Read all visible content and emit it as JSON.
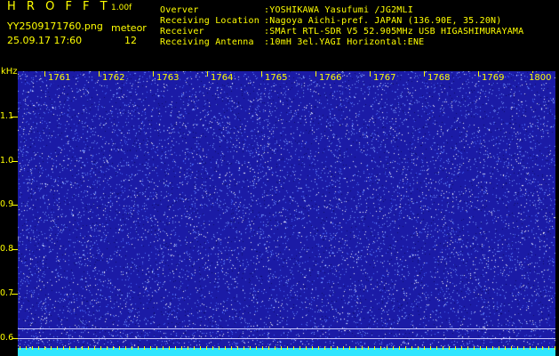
{
  "header": {
    "app_title": "H R O F F T",
    "version": "1.00f",
    "filename": "YY2509171760.png",
    "datetime": "25.09.17 17:60",
    "meteor_label": "meteor",
    "meteor_count": "12",
    "info": [
      {
        "label": "Overver",
        "value": ":YOSHIKAWA Yasufumi /JG2MLI"
      },
      {
        "label": "Receiving Location",
        "value": ":Nagoya Aichi-pref. JAPAN (136.90E, 35.20N)"
      },
      {
        "label": "Receiver",
        "value": ":SMArt RTL-SDR V5 52.905MHz USB HIGASHIMURAYAMA"
      },
      {
        "label": "Receiving Antenna",
        "value": ":10mH 3el.YAGI Horizontal:ENE"
      }
    ]
  },
  "y_axis": {
    "unit": "kHz",
    "ticks": [
      "1.1",
      "1.0",
      "0.9",
      "0.8",
      "0.7",
      "0.6"
    ]
  },
  "time_axis": {
    "labels": [
      "1761",
      "1762",
      "1763",
      "1764",
      "1765",
      "1766",
      "1767",
      "1768",
      "1769",
      "1800"
    ]
  },
  "colors": {
    "background": "#000000",
    "text": "#ffff00",
    "spectrum": "#1b1ba6",
    "noise": "#ffffff",
    "bottom_band": "#2fe6ff"
  }
}
